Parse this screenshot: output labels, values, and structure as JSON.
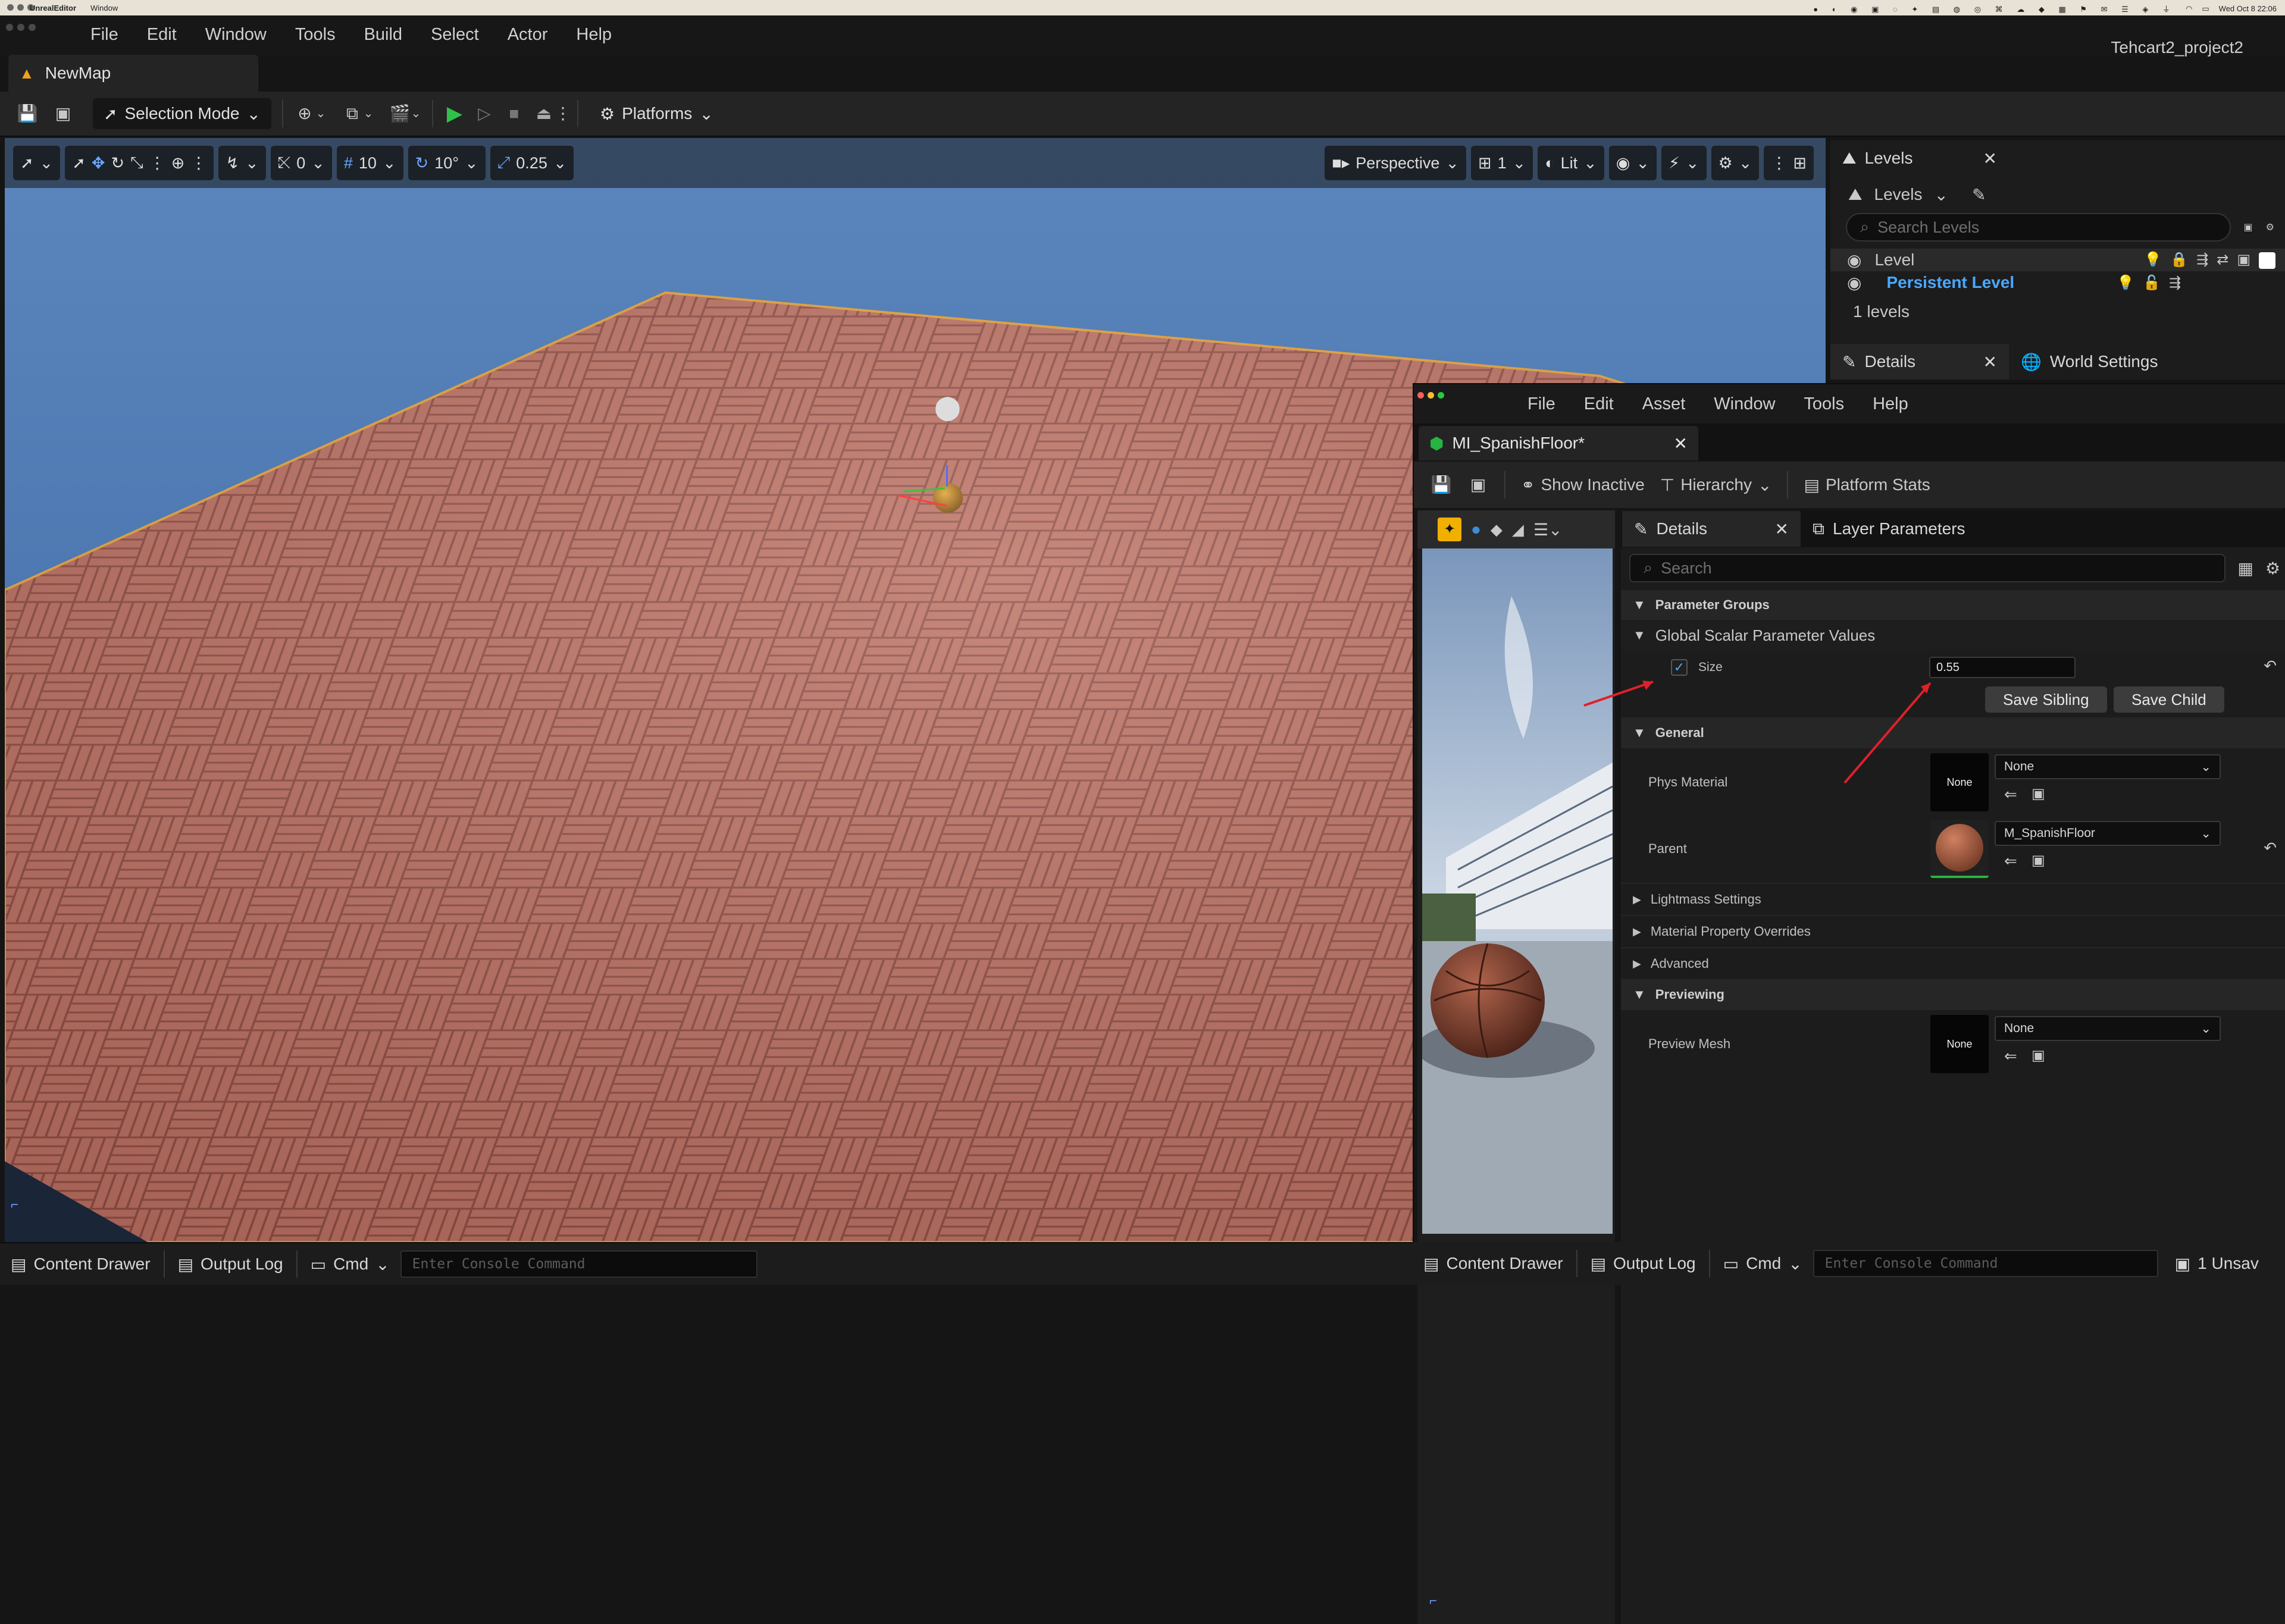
{
  "macos_menubar": {
    "app": "UnrealEditor",
    "menu": "Window",
    "clock": "Wed Oct 8  22:06"
  },
  "main_window": {
    "menu": [
      "File",
      "Edit",
      "Window",
      "Tools",
      "Build",
      "Select",
      "Actor",
      "Help"
    ],
    "project_name": "Tehcart2_project2",
    "map_tab": "NewMap",
    "toolbar": {
      "mode": "Selection Mode",
      "platforms": "Platforms"
    },
    "viewport": {
      "grid_snap": "10",
      "rot_snap": "10°",
      "scale_snap": "0.25",
      "surface_snap": "0",
      "view_mode": "Perspective",
      "layout_count": "1",
      "lighting": "Lit"
    },
    "levels_panel": {
      "tab": "Levels",
      "levels_dropdown": "Levels",
      "search_placeholder": "Search Levels",
      "header": "Level",
      "persistent_level": "Persistent Level",
      "count": "1 levels"
    },
    "details_tab": "Details",
    "world_settings_tab": "World Settings",
    "status_bar": {
      "content_drawer": "Content Drawer",
      "output_log": "Output Log",
      "cmd": "Cmd",
      "console_placeholder": "Enter Console Command"
    }
  },
  "material_window": {
    "menu": [
      "File",
      "Edit",
      "Asset",
      "Window",
      "Tools",
      "Help"
    ],
    "tab": "MI_SpanishFloor*",
    "toolbar": {
      "show_inactive": "Show Inactive",
      "hierarchy": "Hierarchy",
      "platform_stats": "Platform Stats"
    },
    "details_tab": "Details",
    "layer_params_tab": "Layer Parameters",
    "search_placeholder": "Search",
    "sections": {
      "parameter_groups": "Parameter Groups",
      "global_scalar": "Global Scalar Parameter Values",
      "general": "General",
      "lightmass": "Lightmass Settings",
      "material_overrides": "Material Property Overrides",
      "advanced": "Advanced",
      "previewing": "Previewing"
    },
    "size_param": {
      "label": "Size",
      "checked": true,
      "value": "0.55"
    },
    "buttons": {
      "save_sibling": "Save Sibling",
      "save_child": "Save Child"
    },
    "phys_material": {
      "label": "Phys Material",
      "thumb": "None",
      "value": "None"
    },
    "parent": {
      "label": "Parent",
      "value": "M_SpanishFloor"
    },
    "preview_mesh": {
      "label": "Preview Mesh",
      "thumb": "None",
      "value": "None"
    },
    "status_bar": {
      "content_drawer": "Content Drawer",
      "output_log": "Output Log",
      "cmd": "Cmd",
      "console_placeholder": "Enter Console Command",
      "unsaved": "1 Unsav"
    }
  },
  "colors": {
    "accent_green": "#27b342",
    "link_blue": "#4aa8ff",
    "annotation_red": "#e0202a",
    "floor_brick": "#b86a5c",
    "sky": "#4a73a8"
  }
}
